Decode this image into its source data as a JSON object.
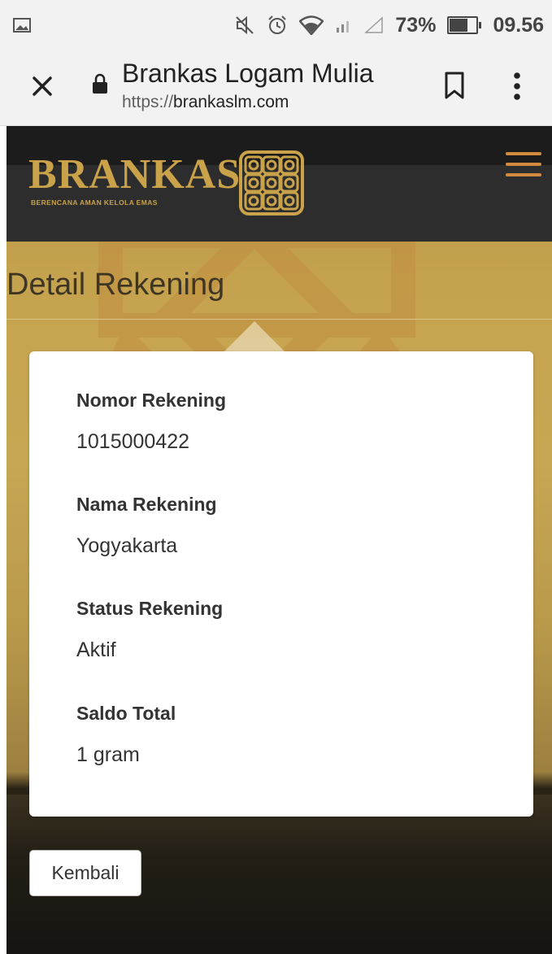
{
  "status_bar": {
    "battery_percent": "73%",
    "battery_level": 0.73,
    "time": "09.56",
    "icons": [
      "image-icon",
      "mute-icon",
      "alarm-icon",
      "wifi-icon",
      "signal-icon",
      "signal-empty-icon",
      "battery-icon"
    ]
  },
  "toolbar": {
    "title": "Brankas Logam Mulia",
    "url_prefix": "https://",
    "url_domain": "brankaslm.com",
    "icons": [
      "close-icon",
      "lock-icon",
      "bookmark-icon",
      "more-vert-icon"
    ]
  },
  "site": {
    "logo_text": "BRANKAS",
    "logo_tagline": "BERENCANA AMAN KELOLA EMAS",
    "accent": "#c9a24a",
    "menu_color": "#d28a3f"
  },
  "page": {
    "heading": "Detail Rekening"
  },
  "account": {
    "fields": [
      {
        "label": "Nomor Rekening",
        "value": "1015000422"
      },
      {
        "label": "Nama Rekening",
        "value": "Yogyakarta"
      },
      {
        "label": "Status Rekening",
        "value": "Aktif"
      },
      {
        "label": "Saldo Total",
        "value": "1 gram"
      }
    ]
  },
  "actions": {
    "back_label": "Kembali"
  }
}
